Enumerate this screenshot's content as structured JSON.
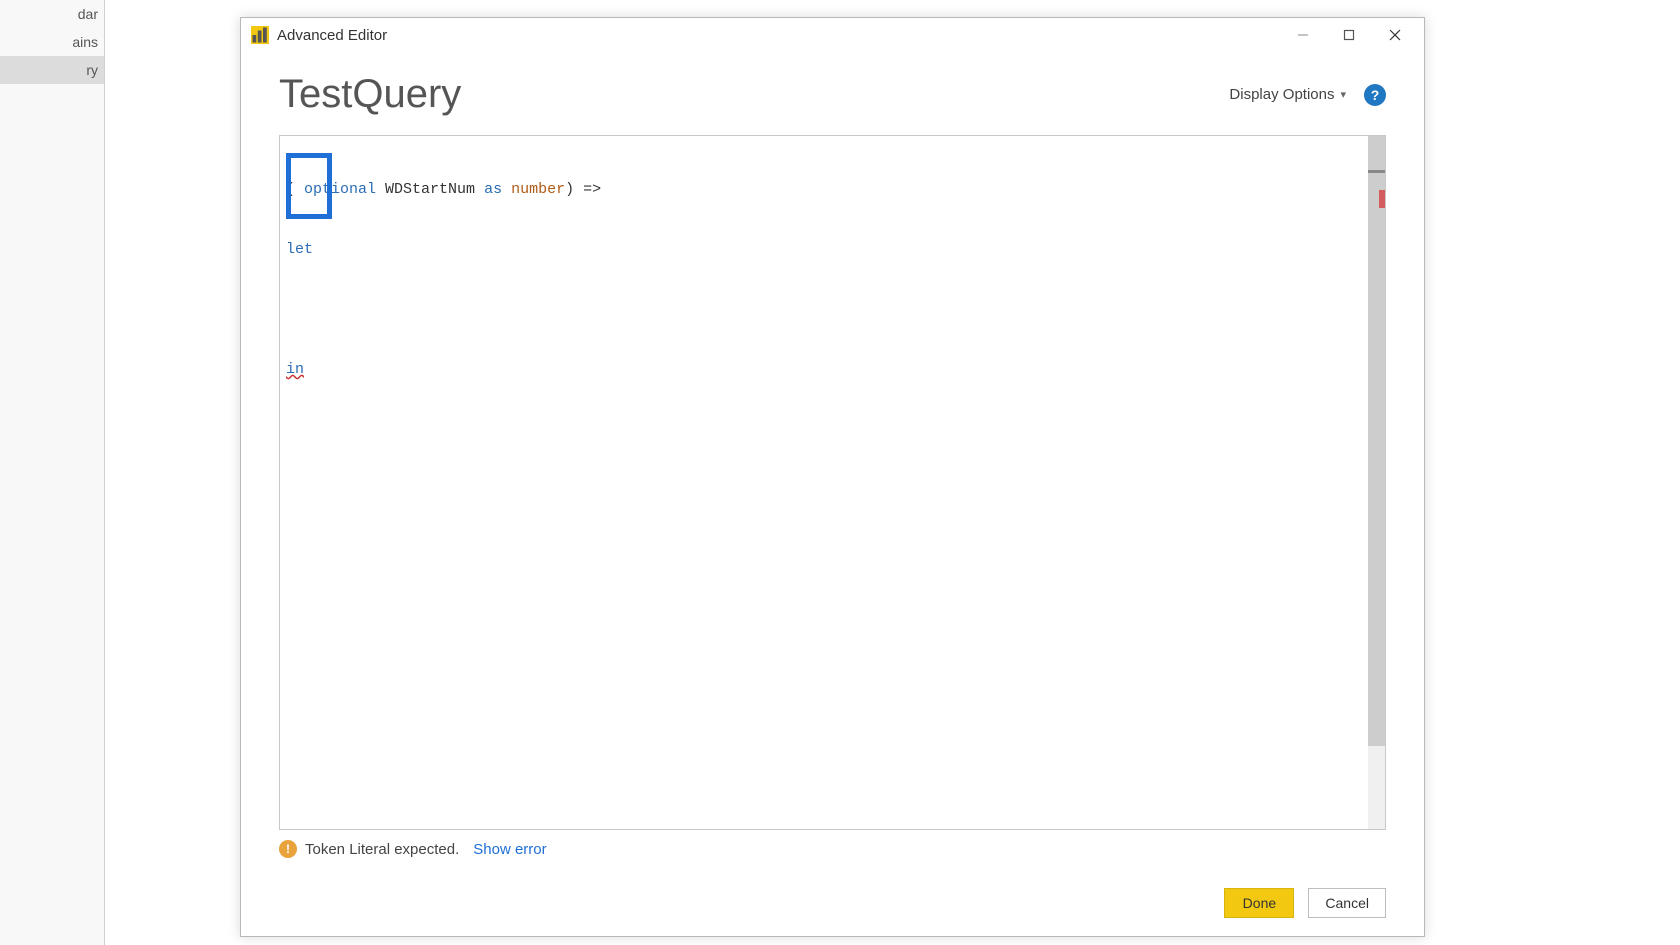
{
  "background": {
    "sidebar_items": [
      "dar",
      "ains",
      "ry"
    ],
    "selected_index": 2
  },
  "dialog": {
    "title": "Advanced Editor",
    "query_name": "TestQuery",
    "display_options_label": "Display Options",
    "code": {
      "line1_prefix": "( ",
      "line1_kw_optional": "optional",
      "line1_ident": " WDStartNum ",
      "line1_kw_as": "as",
      "line1_space": " ",
      "line1_type": "number",
      "line1_suffix": ") =>",
      "line2_let": "let",
      "line3": "",
      "line4_in": "in"
    },
    "error_message": "Token Literal expected.",
    "show_error_label": "Show error",
    "done_label": "Done",
    "cancel_label": "Cancel"
  }
}
